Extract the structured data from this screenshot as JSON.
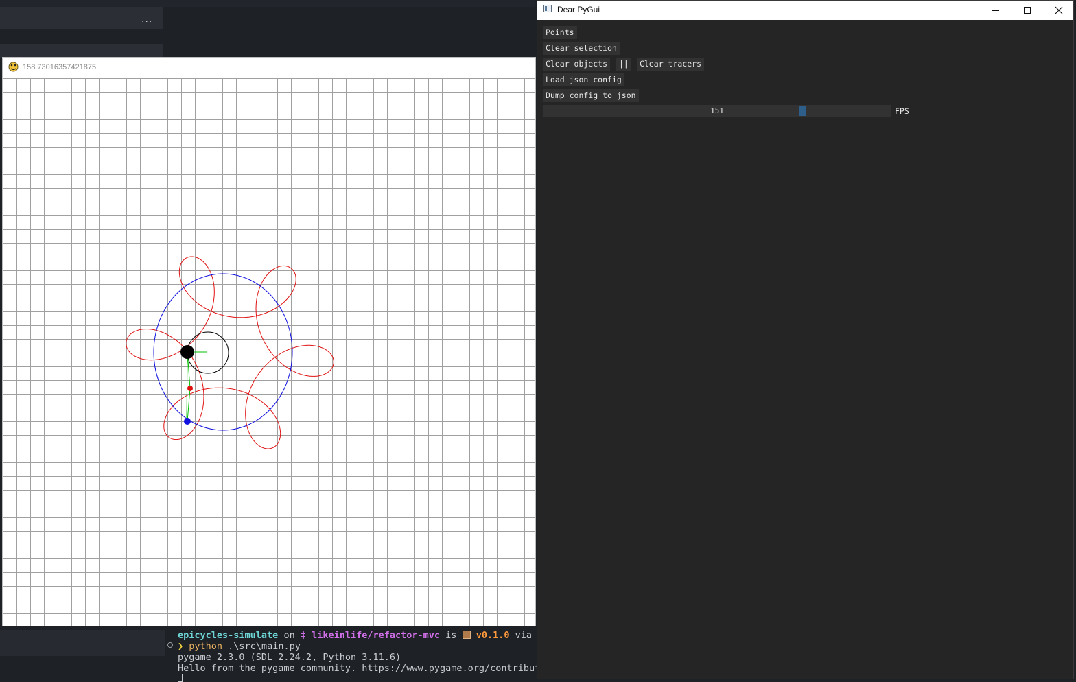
{
  "background": {
    "ellipsis": "···"
  },
  "pygame_window": {
    "title": "158.73016357421875",
    "icon": "python-snake-icon"
  },
  "terminal": {
    "line1": {
      "dir": "epicycles-simulate",
      "on": " on ",
      "branch_icon": "",
      "branch": " likeinlife/refactor-mvc",
      "is": " is ",
      "version": " v0.1.0",
      "via": " via"
    },
    "line2": {
      "prompt": "❯ ",
      "cmd": "python",
      "args": " .\\src\\main.py"
    },
    "line3": "pygame 2.3.0 (SDL 2.24.2, Python 3.11.6)",
    "line4": "Hello from the pygame community. https://www.pygame.org/contribute.html"
  },
  "dpg_window": {
    "title": "Dear PyGui",
    "buttons": {
      "points": "Points",
      "clear_selection": "Clear selection",
      "clear_objects": "Clear objects",
      "pause": "||",
      "clear_tracers": "Clear tracers",
      "load_json": "Load json config",
      "dump_json": "Dump config to json"
    },
    "fps_slider": {
      "value": "151",
      "label": "FPS",
      "accent": "#2e5f8a"
    }
  },
  "colors": {
    "grid_line": "#a0a0a0",
    "tracer": "#e01010",
    "orbit": "#1010e0",
    "arm": "#00c000"
  }
}
